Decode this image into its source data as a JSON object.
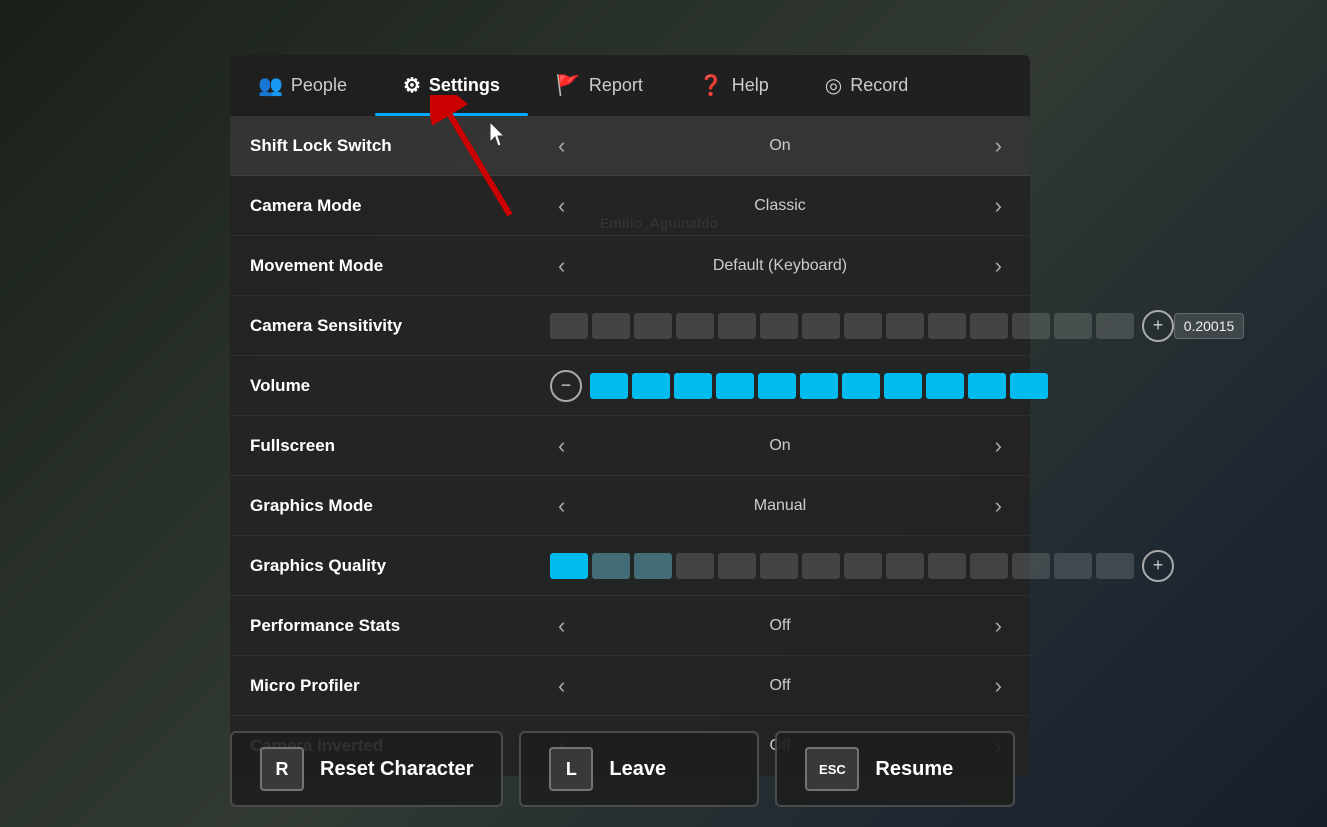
{
  "background": {
    "overlay_color": "rgba(0,0,0,0.45)"
  },
  "character_name": "Emilio_Aguinaldo",
  "tabs": [
    {
      "id": "people",
      "label": "People",
      "icon": "👥",
      "active": false
    },
    {
      "id": "settings",
      "label": "Settings",
      "icon": "⚙",
      "active": true
    },
    {
      "id": "report",
      "label": "Report",
      "icon": "🚩",
      "active": false
    },
    {
      "id": "help",
      "label": "Help",
      "icon": "❓",
      "active": false
    },
    {
      "id": "record",
      "label": "Record",
      "icon": "⊙",
      "active": false
    }
  ],
  "settings": [
    {
      "id": "shift-lock",
      "label": "Shift Lock Switch",
      "type": "toggle",
      "value": "On",
      "highlighted": true
    },
    {
      "id": "camera-mode",
      "label": "Camera Mode",
      "type": "toggle",
      "value": "Classic",
      "highlighted": false
    },
    {
      "id": "movement-mode",
      "label": "Movement Mode",
      "type": "toggle",
      "value": "Default (Keyboard)",
      "highlighted": false
    },
    {
      "id": "camera-sensitivity",
      "label": "Camera Sensitivity",
      "type": "slider",
      "value": "0.20015",
      "filled_segments": 0,
      "total_segments": 14,
      "highlighted": false
    },
    {
      "id": "volume",
      "label": "Volume",
      "type": "slider-minus",
      "filled_segments": 11,
      "total_segments": 11,
      "highlighted": false
    },
    {
      "id": "fullscreen",
      "label": "Fullscreen",
      "type": "toggle",
      "value": "On",
      "highlighted": false
    },
    {
      "id": "graphics-mode",
      "label": "Graphics Mode",
      "type": "toggle",
      "value": "Manual",
      "highlighted": false
    },
    {
      "id": "graphics-quality",
      "label": "Graphics Quality",
      "type": "slider-plus",
      "filled_segments": 1,
      "half_segments": 2,
      "total_segments": 14,
      "highlighted": false
    },
    {
      "id": "performance-stats",
      "label": "Performance Stats",
      "type": "toggle",
      "value": "Off",
      "highlighted": false
    },
    {
      "id": "micro-profiler",
      "label": "Micro Profiler",
      "type": "toggle",
      "value": "Off",
      "highlighted": false
    },
    {
      "id": "camera-inverted",
      "label": "Camera Inverted",
      "type": "toggle",
      "value": "Off",
      "highlighted": false
    }
  ],
  "bottom_buttons": [
    {
      "id": "reset",
      "key": "R",
      "label": "Reset Character"
    },
    {
      "id": "leave",
      "key": "L",
      "label": "Leave"
    },
    {
      "id": "resume",
      "key": "ESC",
      "label": "Resume"
    }
  ]
}
